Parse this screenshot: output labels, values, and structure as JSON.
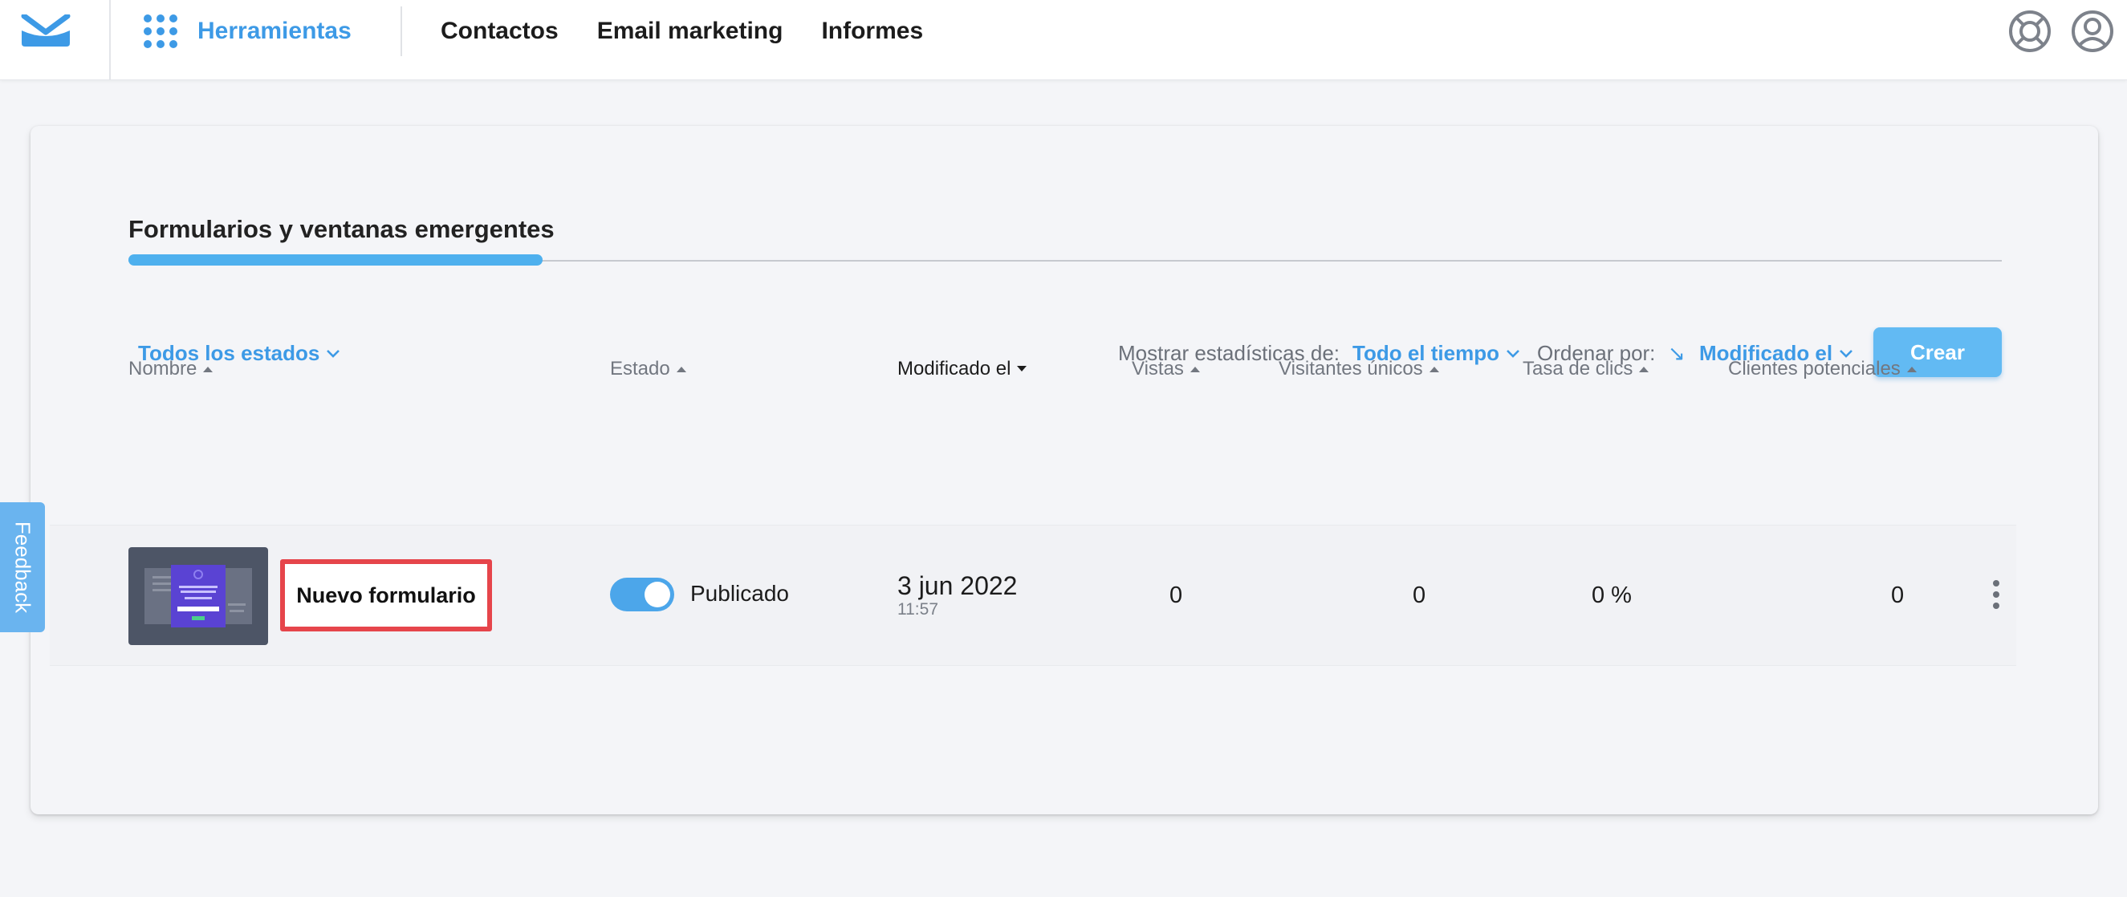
{
  "nav": {
    "logo": "envelope-logo-icon",
    "tools_label": "Herramientas",
    "links": [
      "Contactos",
      "Email marketing",
      "Informes"
    ],
    "icons": [
      "help-lifebuoy-icon",
      "user-account-icon"
    ]
  },
  "page": {
    "tab_title": "Formularios y ventanas emergentes",
    "filter_status": "Todos los estados",
    "stats_label": "Mostrar estadísticas de:",
    "stats_value": "Todo el tiempo",
    "sort_label": "Ordenar por:",
    "sort_direction": "↘",
    "sort_value": "Modificado el",
    "create_button": "Crear"
  },
  "table": {
    "columns": [
      "Nombre",
      "Estado",
      "Modificado el",
      "Vistas",
      "Visitantes únicos",
      "Tasa de clics",
      "Clientes potenciales"
    ],
    "active_column": "Modificado el",
    "rows": [
      {
        "name": "Nuevo formulario",
        "status": "Publicado",
        "published": true,
        "date": "3 jun 2022",
        "time": "11:57",
        "views": "0",
        "unique_visitors": "0",
        "click_rate": "0 %",
        "leads": "0"
      }
    ]
  },
  "feedback_label": "Feedback",
  "colors": {
    "accent": "#3d9ae6",
    "highlight": "#e6454b",
    "button": "#62baf3"
  }
}
